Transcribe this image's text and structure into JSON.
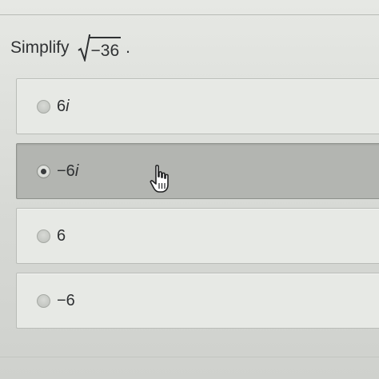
{
  "question": {
    "prompt": "Simplify",
    "radicand": "−36",
    "period": "."
  },
  "options": [
    {
      "label": "6",
      "variable": "i",
      "selected": false
    },
    {
      "label": "−6",
      "variable": "i",
      "selected": true
    },
    {
      "label": "6",
      "variable": "",
      "selected": false
    },
    {
      "label": "−6",
      "variable": "",
      "selected": false
    }
  ],
  "icons": {
    "radio": "radio-button-icon",
    "cursor": "hand-pointer-icon"
  },
  "colors": {
    "background": "#d9dbd7",
    "option_bg": "#e7e9e5",
    "option_selected_bg": "#b3b5b1",
    "text": "#2f3133"
  }
}
